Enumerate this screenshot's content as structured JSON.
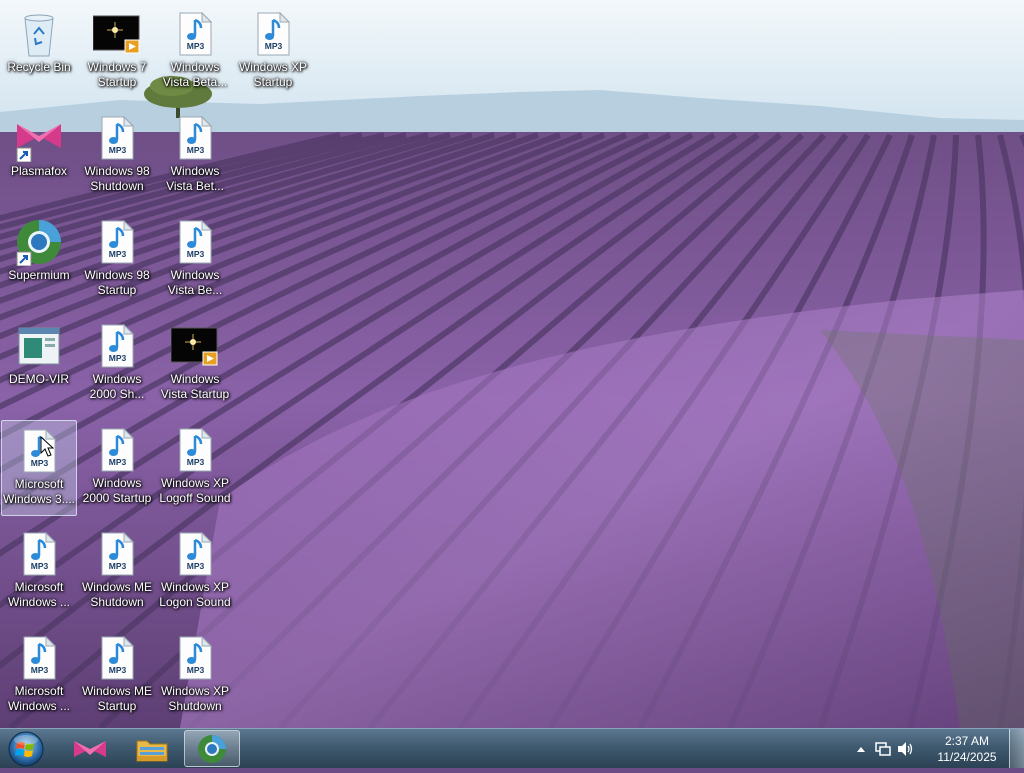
{
  "desktop": {
    "icons": [
      {
        "label": "Recycle Bin",
        "type": "recycle"
      },
      {
        "label": "Windows 7\nStartup",
        "type": "video"
      },
      {
        "label": "Windows\nVista Beta...",
        "type": "mp3"
      },
      {
        "label": "Windows XP\nStartup",
        "type": "mp3"
      },
      {
        "label": "Plasmafox",
        "type": "plasmafox"
      },
      {
        "label": "Windows 98\nShutdown",
        "type": "mp3"
      },
      {
        "label": "Windows\nVista Bet...",
        "type": "mp3"
      },
      {
        "label": "Supermium",
        "type": "supermium"
      },
      {
        "label": "Windows 98\nStartup",
        "type": "mp3"
      },
      {
        "label": "Windows\nVista Be...",
        "type": "mp3"
      },
      {
        "label": "DEMO-VIR",
        "type": "app"
      },
      {
        "label": "Windows\n2000 Sh...",
        "type": "mp3"
      },
      {
        "label": "Windows\nVista Startup",
        "type": "video"
      },
      {
        "label": "Microsoft\nWindows 3....",
        "type": "mp3"
      },
      {
        "label": "Windows\n2000 Startup",
        "type": "mp3"
      },
      {
        "label": "Windows XP\nLogoff Sound",
        "type": "mp3"
      },
      {
        "label": "Microsoft\nWindows ...",
        "type": "mp3"
      },
      {
        "label": "Windows ME\nShutdown",
        "type": "mp3"
      },
      {
        "label": "Windows XP\nLogon Sound",
        "type": "mp3"
      },
      {
        "label": "Microsoft\nWindows ...",
        "type": "mp3"
      },
      {
        "label": "Windows ME\nStartup",
        "type": "mp3"
      },
      {
        "label": "Windows XP\nShutdown",
        "type": "mp3"
      }
    ],
    "mp3_badge": "MP3"
  },
  "taskbar": {
    "pinned": [
      {
        "name": "plasmafox",
        "icon": "plasmafox-icon"
      },
      {
        "name": "file-explorer",
        "icon": "folder-icon"
      },
      {
        "name": "supermium",
        "icon": "supermium-icon"
      }
    ],
    "tray_icons": [
      "show-hidden-icons-arrow",
      "network-icon",
      "volume-icon"
    ],
    "clock": {
      "time": "2:37 AM",
      "date": "11/24/2025"
    }
  },
  "colors": {
    "accent": "#3f5a70",
    "lavender": "#8a5fa8",
    "sky": "#dcebf5"
  }
}
